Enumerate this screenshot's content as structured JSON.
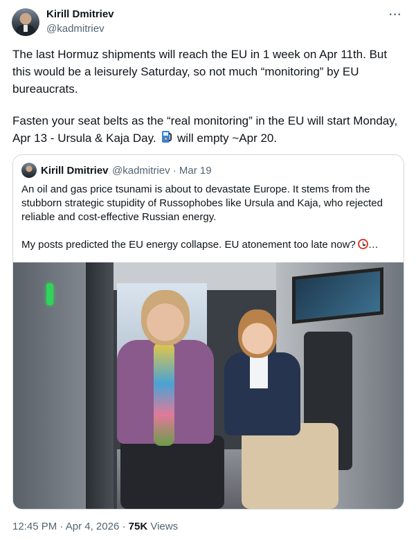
{
  "author": {
    "name": "Kirill Dmitriev",
    "handle": "@kadmitriev"
  },
  "more_icon": "more-horizontal-icon",
  "tweet": {
    "paragraph1": "The last Hormuz shipments will reach the EU in 1 week on Apr 11th. But this would be a leisurely Saturday, so not much “monitoring” by EU bureaucrats.",
    "paragraph2_before": "Fasten your seat belts as the “real monitoring” in the EU will start Monday, Apr 13  - Ursula & Kaja Day.",
    "emoji": "fuel-pump-icon",
    "paragraph2_after": "will empty ~Apr 20."
  },
  "quote": {
    "name": "Kirill Dmitriev",
    "meta": "@kadmitriev · Mar 19",
    "paragraph1": "An oil and gas price tsunami is about to devastate Europe. It stems from the stubborn strategic stupidity of Russophobes like Ursula and Kaja, who rejected reliable and cost-effective Russian energy.",
    "paragraph2": "My posts predicted the EU energy collapse. EU atonement too late now?",
    "emoji": "alarm-clock-icon",
    "ellipsis": "…"
  },
  "footer": {
    "time": "12:45 PM",
    "sep1": " · ",
    "date": "Apr 4, 2026",
    "sep2": " · ",
    "views_count": "75K",
    "views_label": " Views"
  }
}
